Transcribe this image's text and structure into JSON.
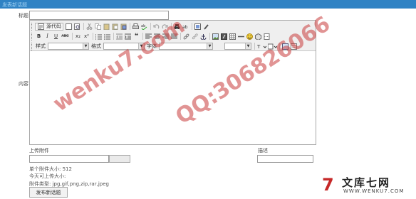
{
  "header": {
    "title": "发表新话题"
  },
  "form": {
    "title_label": "标题",
    "content_label": "内容",
    "title_value": ""
  },
  "editor": {
    "source_button_label": "源代码",
    "bold_label": "B",
    "italic_label": "I",
    "underline_label": "U",
    "strike_label": "ABC",
    "subscript_label": "x₂",
    "superscript_label": "x²",
    "style_label": "样式",
    "format_label": "格式",
    "font_label": "字体",
    "style_value": "",
    "format_value": "",
    "font_value": "",
    "size_value": "",
    "content": ""
  },
  "attachment": {
    "upload_label": "上传附件",
    "description_label": "描述",
    "file_value": "",
    "description_value": "",
    "max_size_text": "单个附件大小: 512",
    "today_text": "今天可上传大小:",
    "types_text": "附件类型: jpg,gif,png,zip,rar,jpeg"
  },
  "actions": {
    "submit_label": "发布新话题"
  },
  "watermarks": {
    "left": "wenku7.com",
    "right": "QQ:306826066"
  },
  "logo": {
    "mark": "7",
    "name": "文库七网",
    "url": "WWW.WENKU7.COM"
  },
  "colors": {
    "topbar": "#2f82c4",
    "watermark": "#c83c3c",
    "logo_accent": "#c62828"
  }
}
